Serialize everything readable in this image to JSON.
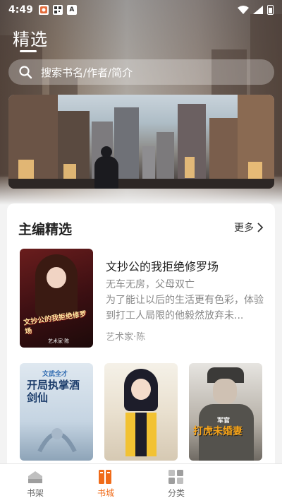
{
  "status_bar": {
    "time": "4:49",
    "notification_icons": [
      "app-notification-icon",
      "qr-icon",
      "a-icon"
    ],
    "a_badge": "A"
  },
  "header": {
    "title": "精选",
    "search_placeholder": "搜索书名/作者/简介"
  },
  "editor_picks": {
    "section_title": "主编精选",
    "more_label": "更多",
    "featured": {
      "title": "文抄公的我拒绝修罗场",
      "description": "无车无房，父母双亡\n为了能让以后的生活更有色彩，体验到打工人局限的他毅然放弃未...",
      "author": "艺术家·陈",
      "cover_title": "文抄公的我拒绝修罗场",
      "cover_publisher": "艺术家·陈"
    },
    "covers": [
      {
        "title_art": "开局执掌酒剑仙",
        "subtitle_art": "文武全才"
      },
      {
        "title_art": ""
      },
      {
        "title_art": "打虎未婚妻",
        "subtitle_art": "军官"
      }
    ]
  },
  "bottom_nav": {
    "items": [
      {
        "label": "书架",
        "icon": "bookshelf-icon",
        "active": false
      },
      {
        "label": "书城",
        "icon": "bookstore-icon",
        "active": true
      },
      {
        "label": "分类",
        "icon": "category-icon",
        "active": false
      }
    ]
  },
  "colors": {
    "accent": "#f06b19",
    "inactive_nav": "#666666"
  }
}
